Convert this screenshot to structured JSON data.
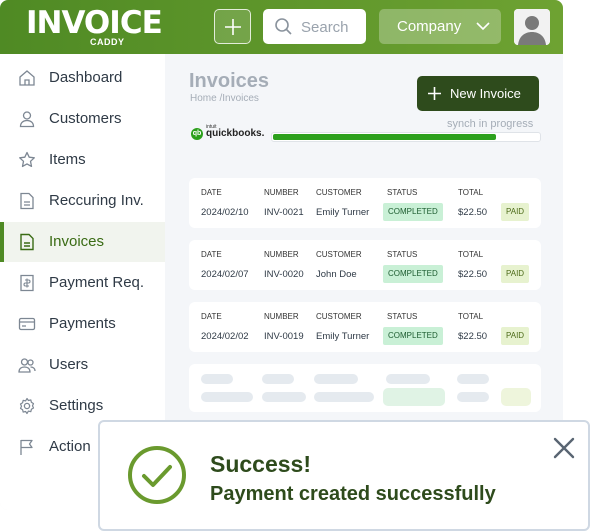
{
  "header": {
    "logo_main": "INVOICE",
    "logo_sub": "CADDY",
    "add_icon": "plus-icon",
    "search_placeholder": "Search",
    "company_label": "Company",
    "brand_color": "#5a9a2b"
  },
  "sidebar": {
    "items": [
      {
        "label": "Dashboard",
        "icon": "home-icon"
      },
      {
        "label": "Customers",
        "icon": "user-icon"
      },
      {
        "label": "Items",
        "icon": "star-icon"
      },
      {
        "label": "Reccuring Inv.",
        "icon": "document-icon"
      },
      {
        "label": "Invoices",
        "icon": "invoice-icon",
        "active": true
      },
      {
        "label": "Payment Req.",
        "icon": "payment-request-icon"
      },
      {
        "label": "Payments",
        "icon": "card-icon"
      },
      {
        "label": "Users",
        "icon": "users-icon"
      },
      {
        "label": "Settings",
        "icon": "gear-icon"
      },
      {
        "label": "Action",
        "icon": "flag-icon"
      }
    ]
  },
  "main": {
    "title": "Invoices",
    "breadcrumb": "Home /Invoices",
    "new_button": "New Invoice",
    "quickbooks": {
      "small": "intuit",
      "name": "quickbooks.",
      "badge": "qb"
    },
    "sync_label": "synch in progress",
    "sync_progress": 0.84,
    "columns": [
      "DATE",
      "NUMBER",
      "CUSTOMER",
      "STATUS",
      "TOTAL"
    ],
    "rows": [
      {
        "date": "2024/02/10",
        "number": "INV-0021",
        "customer": "Emily Turner",
        "status": "COMPLETED",
        "total": "$22.50",
        "paid": "PAID"
      },
      {
        "date": "2024/02/07",
        "number": "INV-0020",
        "customer": "John Doe",
        "status": "COMPLETED",
        "total": "$22.50",
        "paid": "PAID"
      },
      {
        "date": "2024/02/02",
        "number": "INV-0019",
        "customer": "Emily Turner",
        "status": "COMPLETED",
        "total": "$22.50",
        "paid": "PAID"
      }
    ]
  },
  "toast": {
    "title": "Success!",
    "message": "Payment created successfully",
    "icon": "check-circle-icon",
    "close_icon": "close-icon"
  }
}
